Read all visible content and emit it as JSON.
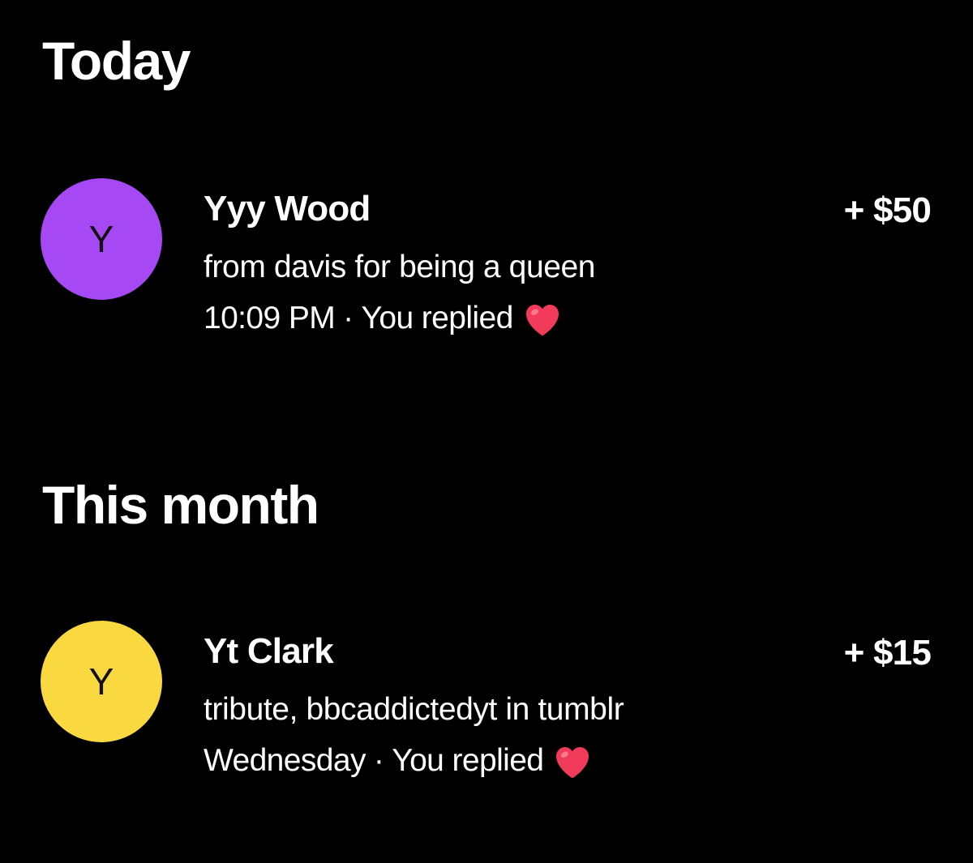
{
  "sections": [
    {
      "title": "Today",
      "items": [
        {
          "avatar_letter": "Y",
          "avatar_color": "#A748F5",
          "name": "Yyy Wood",
          "message": "from davis for being a queen",
          "time": "10:09 PM",
          "separator": "·",
          "status": "You replied",
          "reaction_icon": "heart-icon",
          "amount": "+ $50"
        }
      ]
    },
    {
      "title": "This month",
      "items": [
        {
          "avatar_letter": "Y",
          "avatar_color": "#FAD940",
          "name": "Yt Clark",
          "message": "tribute, bbcaddictedyt in tumblr",
          "time": "Wednesday",
          "separator": "·",
          "status": "You replied",
          "reaction_icon": "heart-icon",
          "amount": "+ $15"
        }
      ]
    }
  ],
  "colors": {
    "background": "#000000",
    "text": "#FFFFFF",
    "heart": "#F23B5A"
  }
}
